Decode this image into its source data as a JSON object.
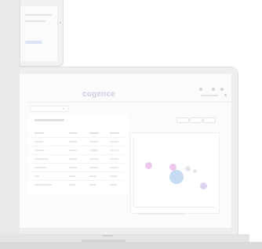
{
  "app": {
    "logo": "cogence"
  },
  "colors": {
    "accent": "#c9cfe2",
    "bubble_pink": "#f0c8ef",
    "bubble_blue": "#c7dcf3",
    "bubble_lavender": "#dcd4f1",
    "bubble_dark": "#e6e6ee"
  }
}
